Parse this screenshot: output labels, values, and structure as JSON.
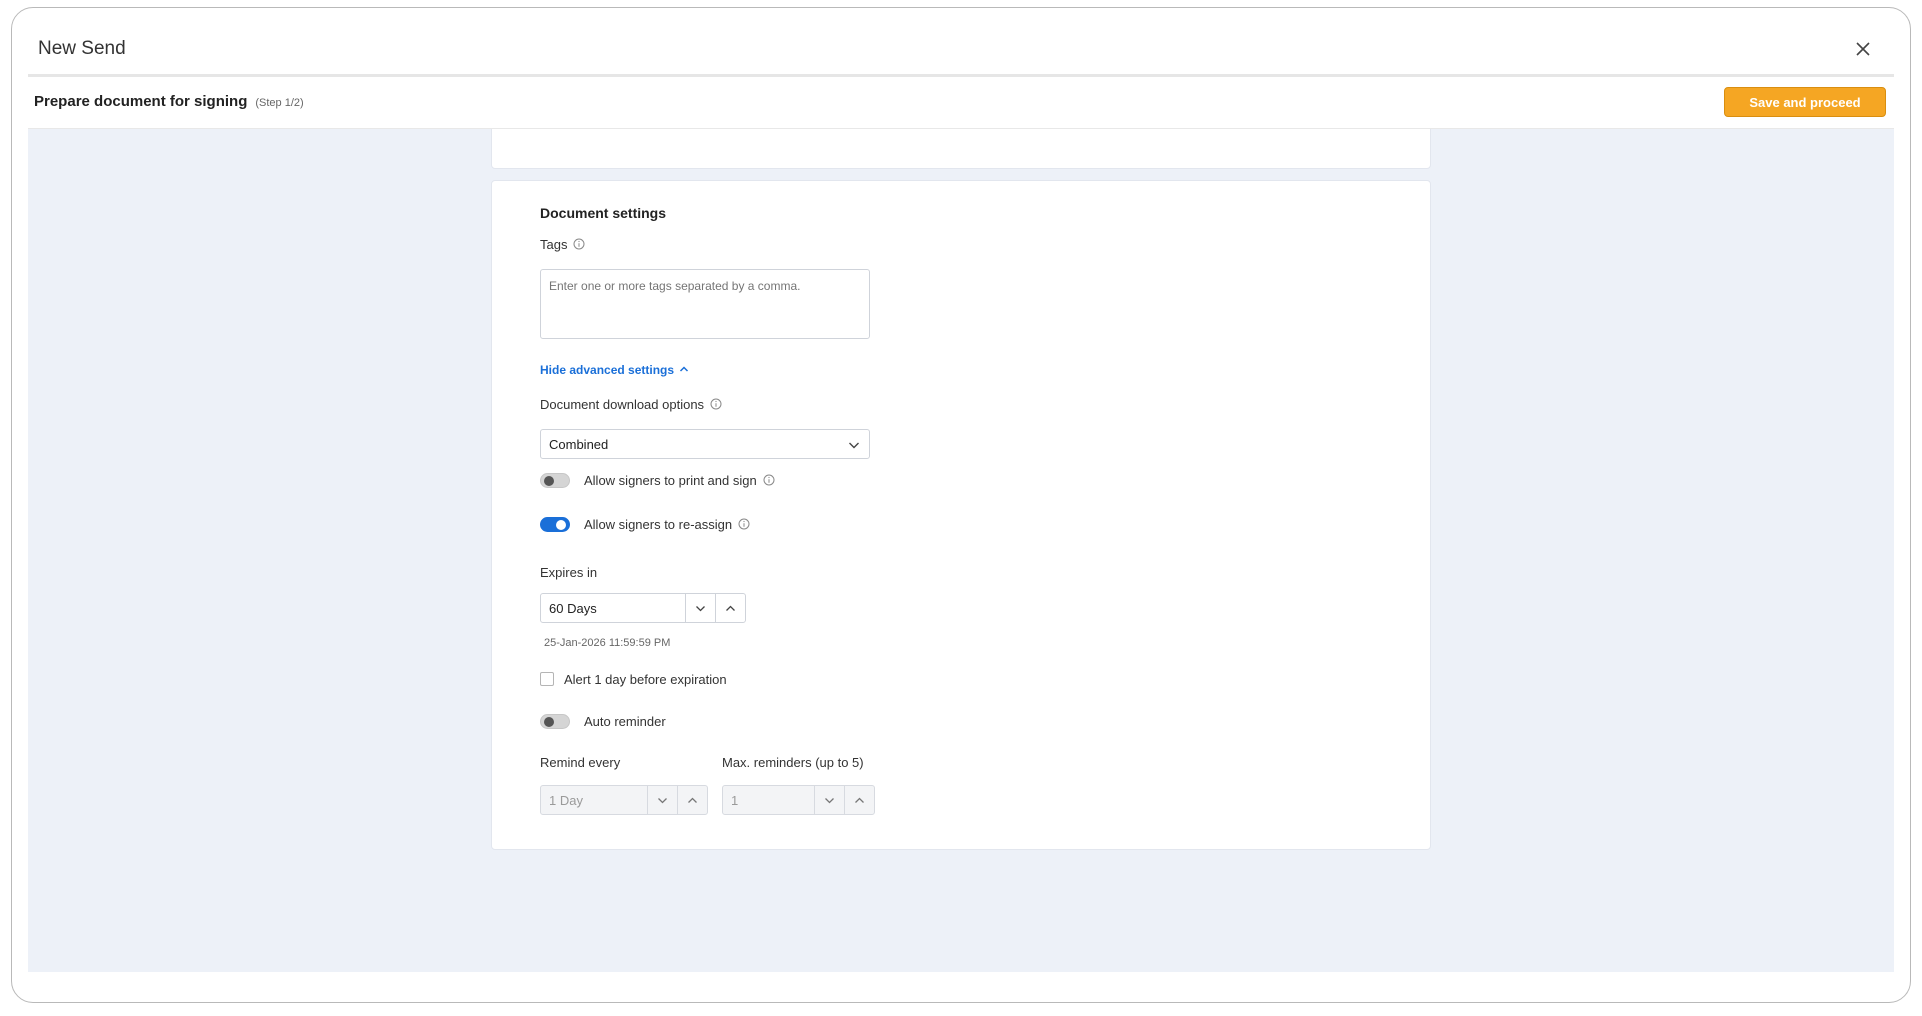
{
  "window": {
    "title": "New Send"
  },
  "stepbar": {
    "title": "Prepare document for signing",
    "step": "(Step 1/2)",
    "save_label": "Save and proceed"
  },
  "document_settings": {
    "heading": "Document settings",
    "tags": {
      "label": "Tags",
      "placeholder": "Enter one or more tags separated by a comma.",
      "value": ""
    },
    "advanced_toggle_label": "Hide advanced settings",
    "download_options": {
      "label": "Document download options",
      "selected": "Combined"
    },
    "allow_print_sign": {
      "label": "Allow signers to print and sign",
      "enabled": false
    },
    "allow_reassign": {
      "label": "Allow signers to re-assign",
      "enabled": true
    },
    "expires": {
      "label": "Expires in",
      "value": "60 Days",
      "date_hint": "25-Jan-2026 11:59:59 PM"
    },
    "alert_before": {
      "label": "Alert 1 day before expiration",
      "checked": false
    },
    "auto_reminder": {
      "label": "Auto reminder",
      "enabled": false
    },
    "remind_every": {
      "label": "Remind every",
      "value": "1 Day"
    },
    "max_reminders": {
      "label": "Max. reminders (up to 5)",
      "value": "1"
    }
  },
  "colors": {
    "accent": "#1a6fd8",
    "primary_button": "#f5a623",
    "content_bg": "#edf1f8"
  },
  "icons": [
    "close-icon",
    "info-icon",
    "chevron-up-icon",
    "chevron-down-icon"
  ]
}
